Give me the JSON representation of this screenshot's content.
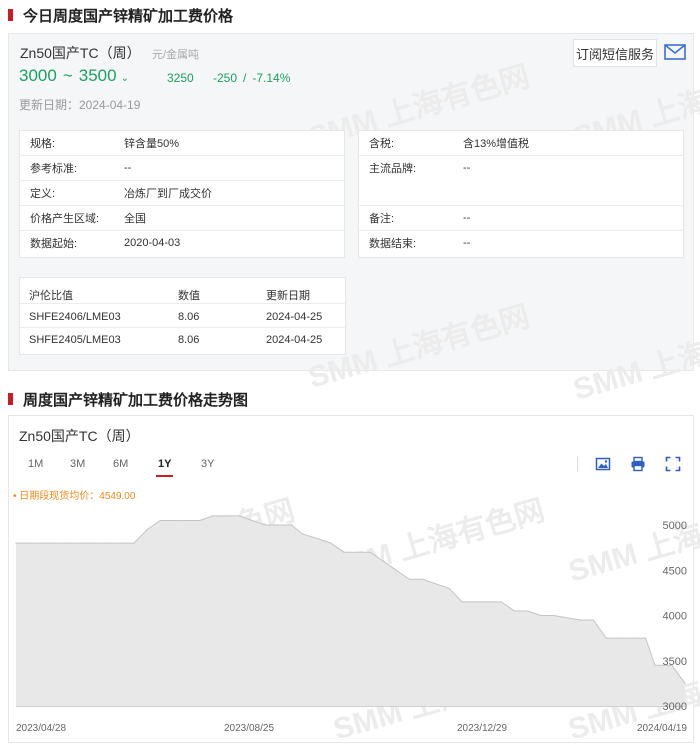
{
  "section1": {
    "title": "今日周度国产锌精矿加工费价格"
  },
  "product": {
    "name": "Zn50国产TC（周）",
    "unit": "元/金属吨",
    "subscribe_label": "订阅短信服务",
    "price_low": "3000",
    "price_high": "3500",
    "tilde": "~",
    "trend_glyph": "⌄",
    "avg": "3250",
    "change": "-250",
    "change_sep": "/",
    "change_pct": "-7.14%",
    "update": "更新日期：2024-04-19"
  },
  "attributes_left": [
    {
      "k": "规格:",
      "v": "锌含量50%"
    },
    {
      "k": "参考标准:",
      "v": "--"
    },
    {
      "k": "定义:",
      "v": "冶炼厂到厂成交价"
    },
    {
      "k": "价格产生区域:",
      "v": "全国"
    },
    {
      "k": "数据起始:",
      "v": "2020-04-03"
    }
  ],
  "attributes_right": [
    {
      "k": "含税:",
      "v": "含13%增值税"
    },
    {
      "k": "主流品牌:",
      "v": "--"
    },
    {
      "k": "备注:",
      "v": "--"
    },
    {
      "k": "数据结束:",
      "v": "--"
    }
  ],
  "ratio_table": {
    "headers": [
      "沪伦比值",
      "数值",
      "更新日期"
    ],
    "rows": [
      [
        "SHFE2406/LME03",
        "8.06",
        "2024-04-25"
      ],
      [
        "SHFE2405/LME03",
        "8.06",
        "2024-04-25"
      ]
    ]
  },
  "section2": {
    "title": "周度国产锌精矿加工费价格走势图"
  },
  "chart_panel": {
    "title": "Zn50国产TC（周）",
    "tabs": [
      "1M",
      "3M",
      "6M",
      "1Y",
      "3Y"
    ],
    "active_tab": "1Y",
    "spot_label": "• 日期段现货均价：4549.00",
    "tools": [
      "image-icon",
      "print-icon",
      "fullscreen-icon"
    ]
  },
  "watermark": "SMM 上海有色网",
  "colors": {
    "accent": "#c91d22",
    "up_down_green": "#1aa260",
    "spot_orange": "#f08a1c",
    "area_fill": "#e8e8e8",
    "line": "#c4c4c4"
  },
  "chart_data": {
    "type": "area",
    "x": [
      "2023-04-28",
      "2023-05-05",
      "2023-05-12",
      "2023-05-19",
      "2023-05-26",
      "2023-06-02",
      "2023-06-09",
      "2023-06-16",
      "2023-06-23",
      "2023-06-30",
      "2023-07-07",
      "2023-07-14",
      "2023-07-21",
      "2023-07-28",
      "2023-08-04",
      "2023-08-11",
      "2023-08-18",
      "2023-08-25",
      "2023-09-01",
      "2023-09-08",
      "2023-09-15",
      "2023-09-22",
      "2023-09-28",
      "2023-10-06",
      "2023-10-13",
      "2023-10-20",
      "2023-10-27",
      "2023-11-03",
      "2023-11-10",
      "2023-11-17",
      "2023-11-24",
      "2023-12-01",
      "2023-12-08",
      "2023-12-15",
      "2023-12-22",
      "2023-12-29",
      "2024-01-05",
      "2024-01-12",
      "2024-01-19",
      "2024-01-26",
      "2024-02-02",
      "2024-02-09",
      "2024-02-23",
      "2024-03-01",
      "2024-03-08",
      "2024-03-15",
      "2024-03-22",
      "2024-03-29",
      "2024-04-03",
      "2024-04-12",
      "2024-04-19"
    ],
    "series": [
      {
        "values": [
          4800,
          4800,
          4800,
          4800,
          4800,
          4800,
          4800,
          4800,
          4800,
          4800,
          4950,
          5050,
          5050,
          5050,
          5050,
          5100,
          5100,
          5100,
          5050,
          5000,
          5000,
          5000,
          4900,
          4850,
          4800,
          4700,
          4700,
          4700,
          4600,
          4500,
          4400,
          4400,
          4350,
          4300,
          4150,
          4150,
          4150,
          4150,
          4050,
          4050,
          4000,
          4000,
          3950,
          3950,
          3750,
          3750,
          3750,
          3750,
          3450,
          3450,
          3250
        ]
      }
    ],
    "xtick_labels": [
      "2023/04/28",
      "2023/08/25",
      "2023/12/29",
      "2024/04/19"
    ],
    "yticks": [
      3000,
      3500,
      4000,
      4500,
      5000
    ],
    "ylim": [
      3000,
      5000
    ],
    "legend": "none",
    "grid": false
  }
}
